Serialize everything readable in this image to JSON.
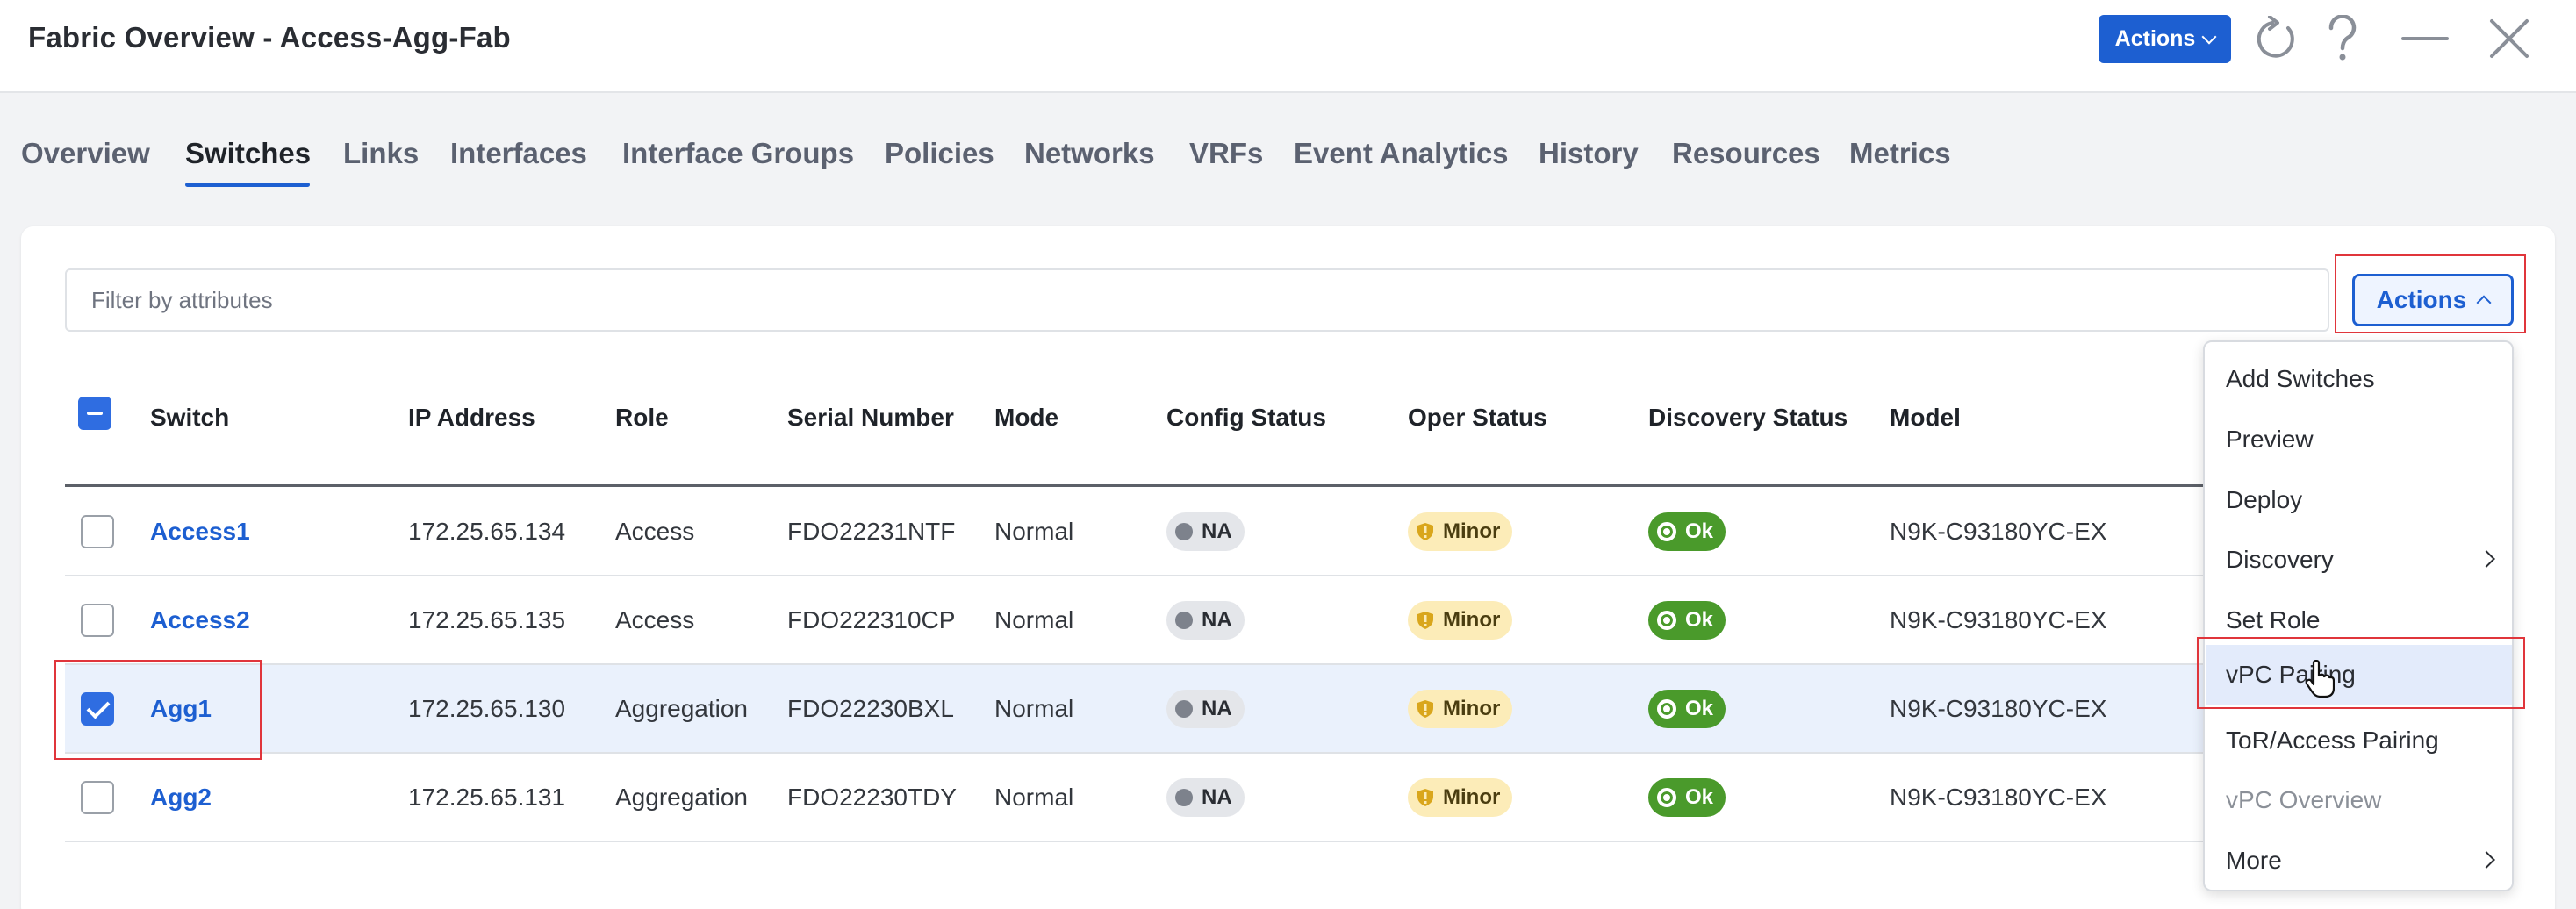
{
  "header": {
    "title": "Fabric Overview - Access-Agg-Fab",
    "actions_label": "Actions"
  },
  "tabs": [
    {
      "label": "Overview"
    },
    {
      "label": "Switches",
      "active": true
    },
    {
      "label": "Links"
    },
    {
      "label": "Interfaces"
    },
    {
      "label": "Interface Groups"
    },
    {
      "label": "Policies"
    },
    {
      "label": "Networks"
    },
    {
      "label": "VRFs"
    },
    {
      "label": "Event Analytics"
    },
    {
      "label": "History"
    },
    {
      "label": "Resources"
    },
    {
      "label": "Metrics"
    }
  ],
  "toolbar": {
    "filter_placeholder": "Filter by attributes",
    "actions_label": "Actions"
  },
  "table": {
    "columns": [
      "Switch",
      "IP Address",
      "Role",
      "Serial Number",
      "Mode",
      "Config Status",
      "Oper Status",
      "Discovery Status",
      "Model"
    ],
    "rows": [
      {
        "switch": "Access1",
        "ip": "172.25.65.134",
        "role": "Access",
        "serial": "FDO22231NTF",
        "mode": "Normal",
        "config": "NA",
        "oper": "Minor",
        "discovery": "Ok",
        "model": "N9K-C93180YC-EX",
        "selected": false
      },
      {
        "switch": "Access2",
        "ip": "172.25.65.135",
        "role": "Access",
        "serial": "FDO222310CP",
        "mode": "Normal",
        "config": "NA",
        "oper": "Minor",
        "discovery": "Ok",
        "model": "N9K-C93180YC-EX",
        "selected": false
      },
      {
        "switch": "Agg1",
        "ip": "172.25.65.130",
        "role": "Aggregation",
        "serial": "FDO22230BXL",
        "mode": "Normal",
        "config": "NA",
        "oper": "Minor",
        "discovery": "Ok",
        "model": "N9K-C93180YC-EX",
        "selected": true
      },
      {
        "switch": "Agg2",
        "ip": "172.25.65.131",
        "role": "Aggregation",
        "serial": "FDO22230TDY",
        "mode": "Normal",
        "config": "NA",
        "oper": "Minor",
        "discovery": "Ok",
        "model": "N9K-C93180YC-EX",
        "selected": false
      }
    ]
  },
  "menu": {
    "items": [
      {
        "label": "Add Switches"
      },
      {
        "label": "Preview"
      },
      {
        "label": "Deploy"
      },
      {
        "label": "Discovery",
        "submenu": true
      },
      {
        "label": "Set Role"
      },
      {
        "label": "vPC Pairing",
        "highlighted": true
      },
      {
        "label": "ToR/Access Pairing"
      },
      {
        "label": "vPC Overview",
        "disabled": true
      },
      {
        "label": "More",
        "submenu": true
      }
    ]
  },
  "colors": {
    "accent": "#1d5fd1",
    "annotation": "#e0353b",
    "ok": "#4a9a2b",
    "minor": "#fcecb8"
  }
}
